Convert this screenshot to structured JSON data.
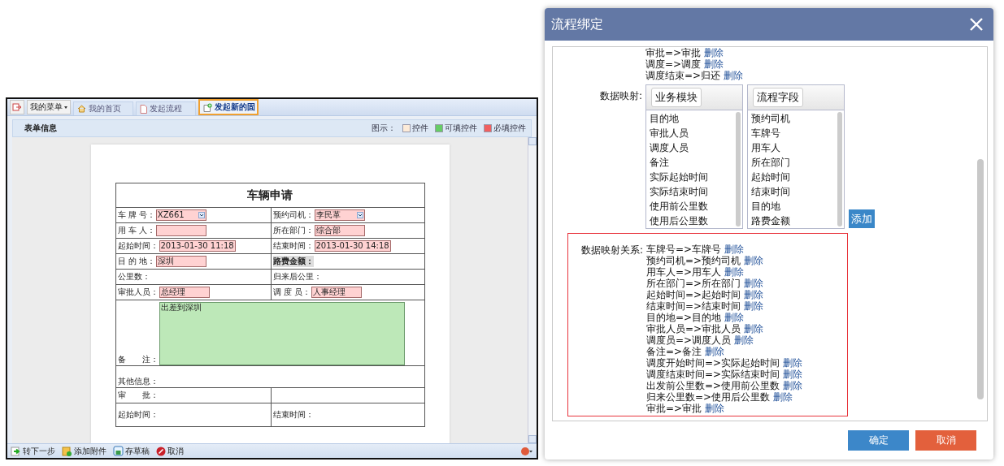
{
  "app": {
    "menu_button": "我的菜单",
    "tabs": [
      {
        "label": "我的首页",
        "kind": "home",
        "selected": false
      },
      {
        "label": "发起流程",
        "kind": "page",
        "selected": false
      },
      {
        "label": "发起新的固",
        "kind": "new",
        "selected": true
      }
    ],
    "section_title": "表单信息",
    "legend": {
      "label": "图示：",
      "items": [
        {
          "label": "控件",
          "color": "#fdebd8"
        },
        {
          "label": "可填控件",
          "color": "#66cc66"
        },
        {
          "label": "必填控件",
          "color": "#f06060"
        }
      ]
    },
    "form": {
      "title": "车辆申请",
      "rows": [
        {
          "kind": "pair",
          "cells": [
            {
              "label": "车 牌 号：",
              "highlighted": false,
              "field": {
                "kind": "select",
                "required": true,
                "value": "XZ661"
              }
            },
            {
              "label": "预约司机：",
              "highlighted": false,
              "field": {
                "kind": "select",
                "required": true,
                "value": "李民革"
              }
            }
          ]
        },
        {
          "kind": "pair",
          "cells": [
            {
              "label": "用 车 人：",
              "highlighted": false,
              "field": {
                "kind": "text",
                "required": true
              }
            },
            {
              "label": "所在部门：",
              "highlighted": false,
              "field": {
                "kind": "text",
                "required": true,
                "value": "综合部"
              }
            }
          ]
        },
        {
          "kind": "pair",
          "cells": [
            {
              "label": "起始时间：",
              "highlighted": false,
              "field": {
                "kind": "text",
                "required": true,
                "value": "2013-01-30 11:18"
              }
            },
            {
              "label": "结束时间：",
              "highlighted": false,
              "field": {
                "kind": "text",
                "required": true,
                "value": "2013-01-30 14:18"
              }
            }
          ]
        },
        {
          "kind": "pair",
          "cells": [
            {
              "label": "目 的 地：",
              "highlighted": false,
              "field": {
                "kind": "text",
                "required": true,
                "value": "深圳"
              }
            },
            {
              "label": "路费金额：",
              "highlighted": true
            }
          ]
        },
        {
          "kind": "pair",
          "cells": [
            {
              "label": "公里数：",
              "highlighted": false
            },
            {
              "label": "归来后公里：",
              "highlighted": false
            }
          ]
        },
        {
          "kind": "pair",
          "cells": [
            {
              "label": "审批人员：",
              "highlighted": false,
              "field": {
                "kind": "text",
                "required": true,
                "value": "总经理"
              }
            },
            {
              "label": "调 度 员：",
              "highlighted": false,
              "field": {
                "kind": "text",
                "required": true,
                "value": "人事经理"
              }
            }
          ]
        },
        {
          "kind": "remark",
          "cells": [
            {
              "label": "备　　注：",
              "highlighted": false,
              "colspan": 2,
              "field": {
                "kind": "textarea",
                "required": false,
                "value": "出差到深圳"
              }
            }
          ]
        },
        {
          "kind": "section",
          "cells": [
            {
              "label": "其他信息：",
              "highlighted": false,
              "colspan": 2
            }
          ]
        },
        {
          "kind": "pair",
          "cells": [
            {
              "label": "审　　批：",
              "highlighted": false
            }
          ]
        },
        {
          "kind": "pair-tall",
          "cells": [
            {
              "label": "起始时间：",
              "highlighted": false
            },
            {
              "label": "结束时间：",
              "highlighted": false
            }
          ]
        }
      ]
    },
    "toolbar": [
      {
        "label": "转下一步",
        "kind": "next"
      },
      {
        "label": "添加附件",
        "kind": "attach"
      },
      {
        "label": "存草稿",
        "kind": "save"
      },
      {
        "label": "取消",
        "kind": "cancel"
      }
    ]
  },
  "dialog": {
    "title": "流程绑定",
    "bindings": [
      {
        "text": "审批=>审批",
        "action": "删除"
      },
      {
        "text": "调度=>调度",
        "action": "删除"
      },
      {
        "text": "调度结束=>归还",
        "action": "删除"
      }
    ],
    "mapping_label": "数据映射:",
    "lists": [
      {
        "header": "业务模块",
        "items": [
          "目的地",
          "审批人员",
          "调度人员",
          "备注",
          "实际起始时间",
          "实际结束时间",
          "使用前公里数",
          "使用后公里数"
        ]
      },
      {
        "header": "流程字段",
        "items": [
          "预约司机",
          "车牌号",
          "用车人",
          "所在部门",
          "起始时间",
          "结束时间",
          "目的地",
          "路费金额"
        ]
      }
    ],
    "add_button": "添加",
    "relations_label": "数据映射关系:",
    "relations": [
      {
        "text": "车牌号=>车牌号",
        "action": "删除"
      },
      {
        "text": "预约司机=>预约司机",
        "action": "删除"
      },
      {
        "text": "用车人=>用车人",
        "action": "删除"
      },
      {
        "text": "所在部门=>所在部门",
        "action": "删除"
      },
      {
        "text": "起始时间=>起始时间",
        "action": "删除"
      },
      {
        "text": "结束时间=>结束时间",
        "action": "删除"
      },
      {
        "text": "目的地=>目的地",
        "action": "删除"
      },
      {
        "text": "审批人员=>审批人员",
        "action": "删除"
      },
      {
        "text": "调度员=>调度人员",
        "action": "删除"
      },
      {
        "text": "备注=>备注",
        "action": "删除"
      },
      {
        "text": "调度开始时间=>实际起始时间",
        "action": "删除"
      },
      {
        "text": "调度结束时间=>实际结束时间",
        "action": "删除"
      },
      {
        "text": "出发前公里数=>使用前公里数",
        "action": "删除"
      },
      {
        "text": "归来公里数=>使用后公里数",
        "action": "删除"
      },
      {
        "text": "审批=>审批",
        "action": "删除"
      }
    ],
    "buttons": [
      {
        "label": "确定",
        "kind": "primary"
      },
      {
        "label": "取消",
        "kind": "danger"
      }
    ]
  }
}
